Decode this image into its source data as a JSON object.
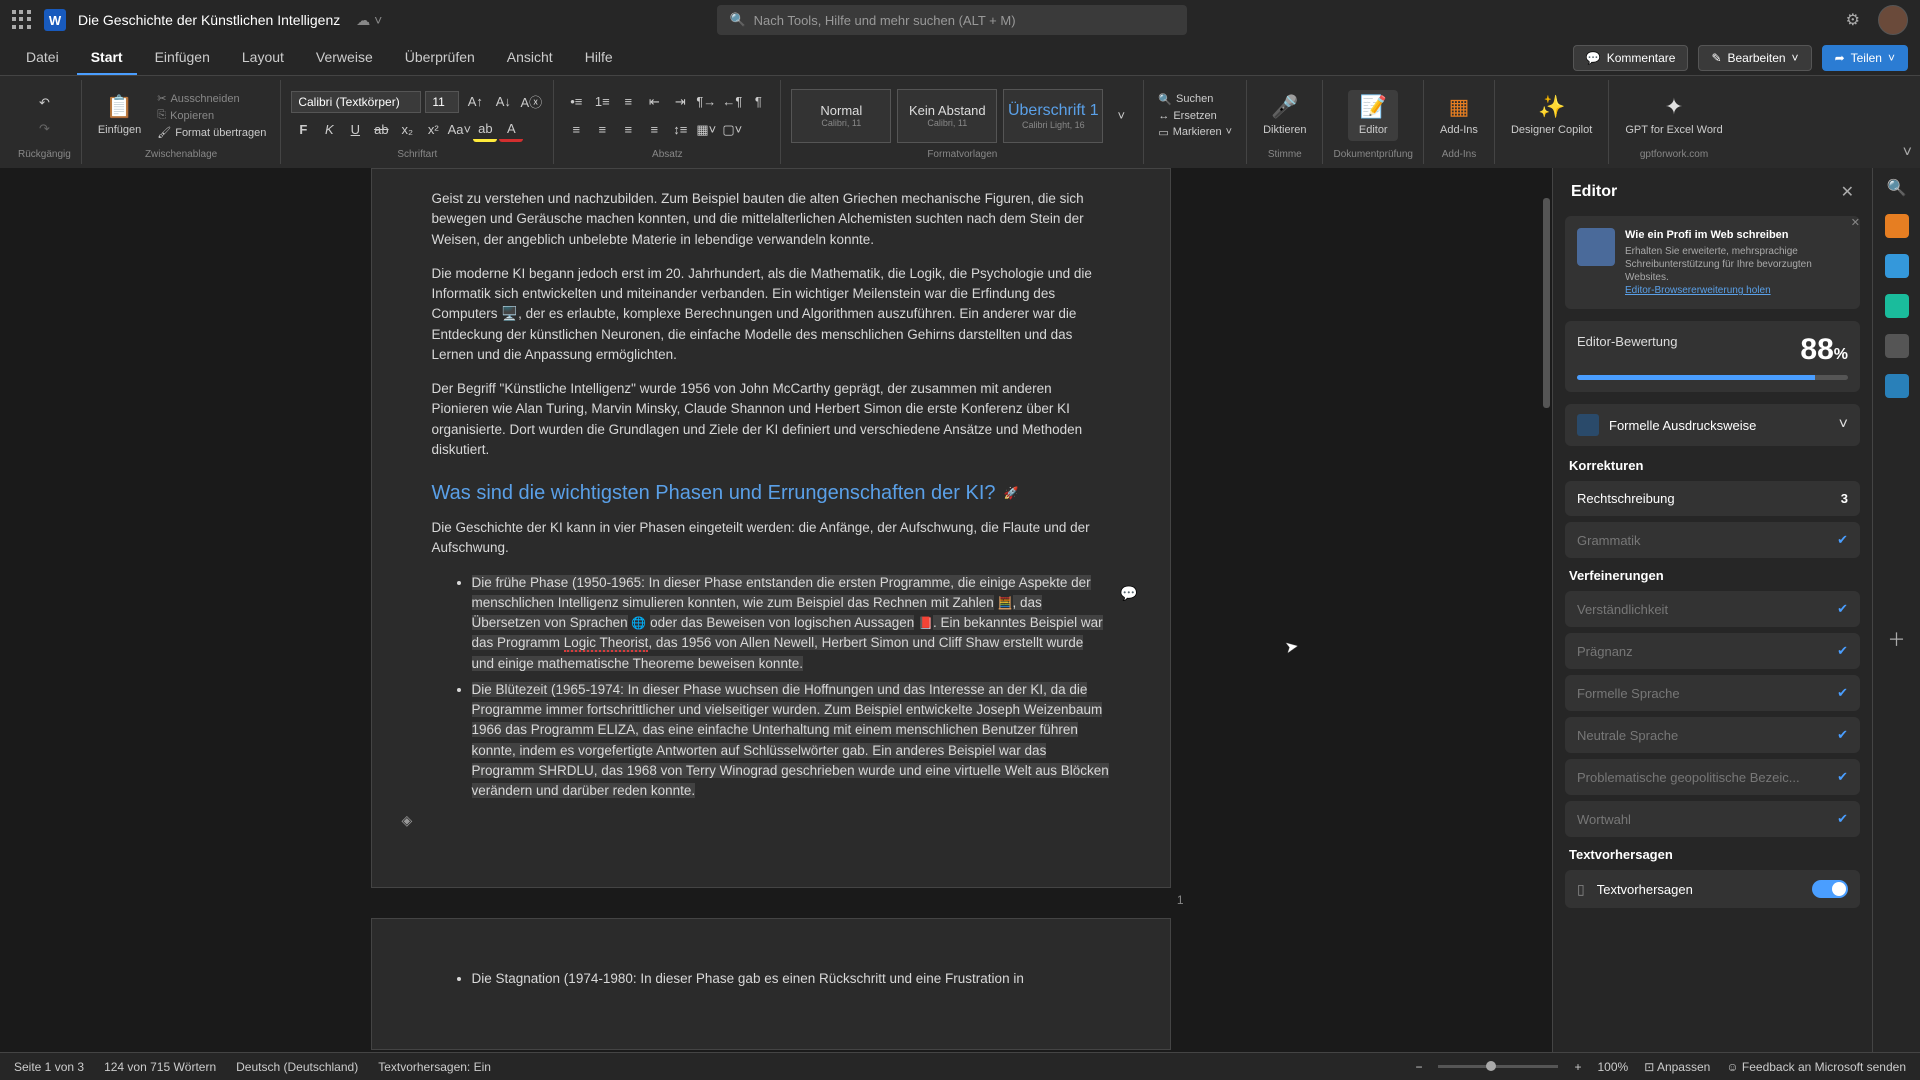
{
  "titlebar": {
    "doc_title": "Die Geschichte der Künstlichen Intelligenz",
    "search_placeholder": "Nach Tools, Hilfe und mehr suchen (ALT + M)"
  },
  "tabs": {
    "items": [
      "Datei",
      "Start",
      "Einfügen",
      "Layout",
      "Verweise",
      "Überprüfen",
      "Ansicht",
      "Hilfe"
    ],
    "active_index": 1,
    "comments": "Kommentare",
    "edit": "Bearbeiten",
    "share": "Teilen"
  },
  "ribbon": {
    "undo_group": "Rückgängig",
    "paste": "Einfügen",
    "cut": "Ausschneiden",
    "copy": "Kopieren",
    "format_painter": "Format übertragen",
    "clipboard_label": "Zwischenablage",
    "font_name": "Calibri (Textkörper)",
    "font_size": "11",
    "font_label": "Schriftart",
    "paragraph_label": "Absatz",
    "styles": {
      "label": "Formatvorlagen",
      "items": [
        {
          "title": "Normal",
          "sub": "Calibri, 11"
        },
        {
          "title": "Kein Abstand",
          "sub": "Calibri, 11"
        },
        {
          "title": "Überschrift 1",
          "sub": "Calibri Light, 16"
        }
      ]
    },
    "editing": {
      "find": "Suchen",
      "replace": "Ersetzen",
      "select": "Markieren"
    },
    "dictate": "Diktieren",
    "voice_label": "Stimme",
    "editor_btn": "Editor",
    "editor_label": "Dokumentprüfung",
    "addins": "Add-Ins",
    "addins_label": "Add-Ins",
    "designer": "Designer Copilot",
    "gpt": "GPT for Excel Word",
    "gpt_label": "gptforwork.com"
  },
  "doc": {
    "p1": "Geist zu verstehen und nachzubilden. Zum Beispiel bauten die alten Griechen mechanische Figuren, die sich bewegen und Geräusche machen konnten, und die mittelalterlichen Alchemisten suchten nach dem Stein der Weisen, der angeblich unbelebte Materie in lebendige verwandeln konnte.",
    "p2": "Die moderne KI begann jedoch erst im 20. Jahrhundert, als die Mathematik, die Logik, die Psychologie und die Informatik sich entwickelten und miteinander verbanden. Ein wichtiger Meilenstein war die Erfindung des Computers 🖥️, der es erlaubte, komplexe Berechnungen und Algorithmen auszuführen. Ein anderer war die Entdeckung der künstlichen Neuronen, die einfache Modelle des menschlichen Gehirns darstellten und das Lernen und die Anpassung ermöglichten.",
    "p3": "Der Begriff \"Künstliche Intelligenz\" wurde 1956 von John McCarthy geprägt, der zusammen mit anderen Pionieren wie Alan Turing, Marvin Minsky, Claude Shannon und Herbert Simon die erste Konferenz über KI organisierte. Dort wurden die Grundlagen und Ziele der KI definiert und verschiedene Ansätze und Methoden diskutiert.",
    "h2": "Was sind die wichtigsten Phasen und Errungenschaften der KI?",
    "p4": "Die Geschichte der KI kann in vier Phasen eingeteilt werden: die Anfänge, der Aufschwung, die Flaute und der Aufschwung.",
    "li1a": "Die frühe Phase (1950-1965: In dieser Phase entstanden die ersten Programme, die einige Aspekte der menschlichen Intelligenz simulieren konnten, wie zum Beispiel das Rechnen mit Zahlen",
    "li1b": ", das Übersetzen von Sprachen",
    "li1c": "oder das Beweisen von logischen Aussagen",
    "li1d": ". Ein bekanntes Beispiel war das Programm ",
    "li1e": "Logic Theorist",
    "li1f": ", das 1956 von Allen Newell, Herbert Simon und Cliff Shaw erstellt wurde und einige mathematische Theoreme beweisen konnte.",
    "li2": "Die Blütezeit (1965-1974: In dieser Phase wuchsen die Hoffnungen und das Interesse an der KI, da die Programme immer fortschrittlicher und vielseitiger wurden. Zum Beispiel entwickelte Joseph Weizenbaum 1966 das Programm ELIZA, das eine einfache Unterhaltung mit einem menschlichen Benutzer führen konnte, indem es vorgefertigte Antworten auf Schlüsselwörter gab. Ein anderes Beispiel war das Programm SHRDLU, das 1968 von Terry Winograd geschrieben wurde und eine virtuelle Welt aus Blöcken verändern und darüber reden konnte.",
    "page_num": "1",
    "li3": "Die Stagnation (1974-1980: In dieser Phase gab es einen Rückschritt und eine Frustration in"
  },
  "editor": {
    "title": "Editor",
    "promo_title": "Wie ein Profi im Web schreiben",
    "promo_body": "Erhalten Sie erweiterte, mehrsprachige Schreibunterstützung für Ihre bevorzugten Websites.",
    "promo_link": "Editor-Browsererweiterung holen",
    "score_label": "Editor-Bewertung",
    "score_value": "88",
    "score_suffix": "%",
    "style_label": "Formelle Ausdrucksweise",
    "corrections_h": "Korrekturen",
    "spelling_label": "Rechtschreibung",
    "spelling_count": "3",
    "grammar_label": "Grammatik",
    "refinements_h": "Verfeinerungen",
    "ref_items": [
      "Verständlichkeit",
      "Prägnanz",
      "Formelle Sprache",
      "Neutrale Sprache",
      "Problematische geopolitische Bezeic...",
      "Wortwahl"
    ],
    "predictions_h": "Textvorhersagen",
    "predictions_label": "Textvorhersagen"
  },
  "statusbar": {
    "page": "Seite 1 von 3",
    "words": "124 von 715 Wörtern",
    "lang": "Deutsch (Deutschland)",
    "predictions": "Textvorhersagen: Ein",
    "fit": "Anpassen",
    "zoom": "100%",
    "feedback": "Feedback an Microsoft senden"
  }
}
